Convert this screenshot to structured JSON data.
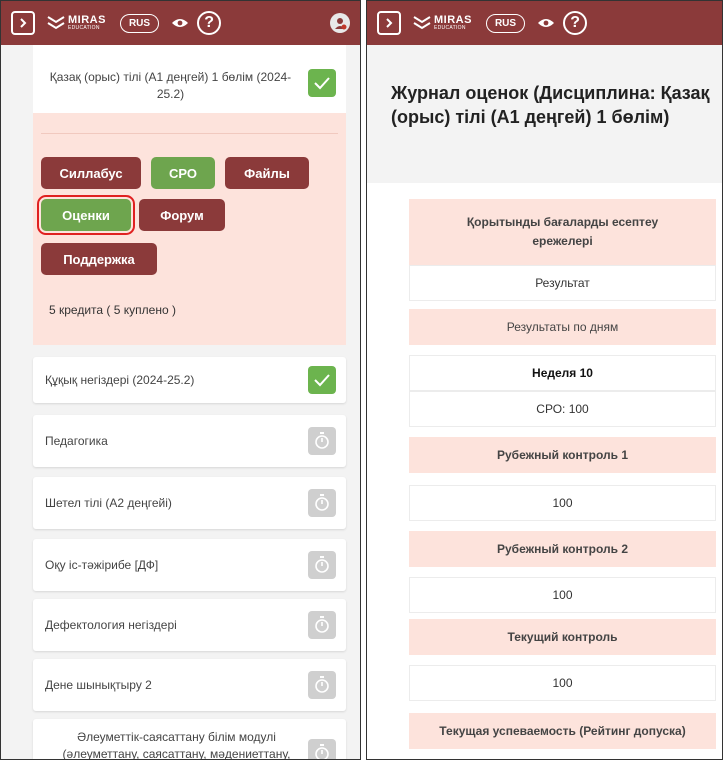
{
  "topbar": {
    "logo_name": "MIRAS",
    "logo_sub": "EDUCATION",
    "language": "RUS",
    "help": "?",
    "icons": [
      "chevron-right-icon",
      "miras-logo-icon",
      "eye-icon",
      "help-icon",
      "avatar-icon"
    ],
    "color": "#8b3a3a"
  },
  "left": {
    "expanded_course": {
      "title": "Қазақ (орыс) тілі (А1 деңгей) 1 бөлім (2024-25.2)",
      "status": "done",
      "buttons": {
        "syllabus": "Силлабус",
        "sro": "СРО",
        "files": "Файлы",
        "grades": "Оценки",
        "forum": "Форум",
        "support": "Поддержка"
      },
      "credits": "5 кредита ( 5 куплено )"
    },
    "courses": [
      {
        "title": "Құқық негіздері (2024-25.2)",
        "status": "done"
      },
      {
        "title": "Педагогика",
        "status": "pending"
      },
      {
        "title": "Шетел тілі (А2 деңгейі)",
        "status": "pending"
      },
      {
        "title": "Оқу іс-тәжірибе [ДФ]",
        "status": "pending"
      },
      {
        "title": "Дефектология негіздері",
        "status": "pending"
      },
      {
        "title": "Дене шынықтыру 2",
        "status": "pending"
      },
      {
        "title": "Әлеуметтік-саясаттану білім модулі (әлеуметтану, саясаттану, мәдениеттану,",
        "status": "pending"
      }
    ]
  },
  "right": {
    "title": "Журнал оценок (Дисциплина: Қазақ (орыс) тілі (А1 деңгей) 1 бөлім)",
    "rows": {
      "rules": "Қорытынды бағаларды есептеу ережелері",
      "result": "Результат",
      "by_days": "Результаты по дням",
      "week": "Неделя 10",
      "sro": "СРО: 100",
      "rk1": "Рубежный контроль 1",
      "rk1_value": "100",
      "rk2": "Рубежный контроль 2",
      "rk2_value": "100",
      "current": "Текущий контроль",
      "current_value": "100",
      "performance": "Текущая успеваемость (Рейтинг допуска)"
    }
  },
  "colors": {
    "accent": "#8b3a3a",
    "green": "#6ea54e",
    "pink": "#fde3dc",
    "selected_outline": "#e02020"
  }
}
